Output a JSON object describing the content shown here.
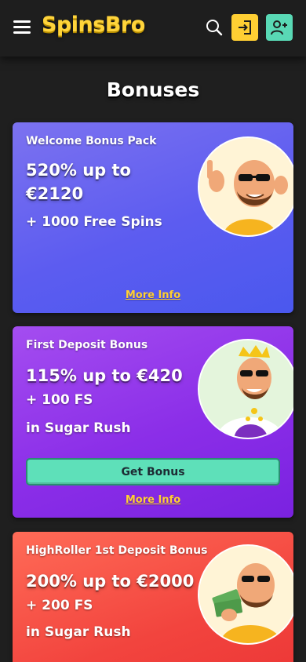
{
  "header": {
    "logo": "SpinsBro",
    "menu_icon": "hamburger-menu-icon",
    "search_icon": "search-icon",
    "login_icon": "login-icon",
    "register_icon": "add-user-icon",
    "login_color": "#ffcf33",
    "register_color": "#59d9b5"
  },
  "page": {
    "title": "Bonuses"
  },
  "cards": [
    {
      "subtitle": "Welcome Bonus Pack",
      "amount_line1": "520% up to",
      "amount_line2": "€2120",
      "extra": "+ 1000 Free Spins",
      "more_info": "More Info",
      "color": "#5c5cf0"
    },
    {
      "subtitle": "First Deposit Bonus",
      "amount_line1": "115% up to €420",
      "extra": "+ 100 FS",
      "game": "in Sugar Rush",
      "button": "Get Bonus",
      "more_info": "More Info",
      "color": "#8b2ee8"
    },
    {
      "subtitle": "HighRoller 1st Deposit Bonus",
      "amount_line1": "200% up to €2000",
      "extra": "+ 200 FS",
      "game": "in Sugar Rush",
      "color": "#f2443e"
    }
  ]
}
